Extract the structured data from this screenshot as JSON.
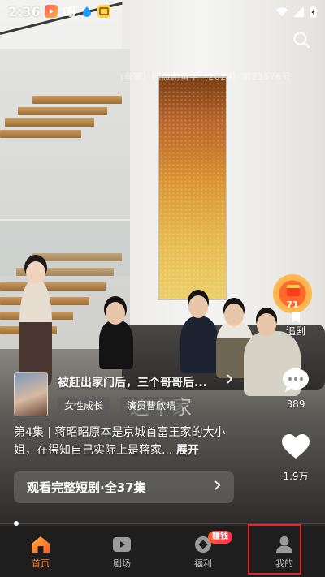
{
  "status_bar": {
    "time": "2:36",
    "app_icons": [
      "video-app-icon",
      "baidu-style-app-icon",
      "water-drop-app-icon",
      "coupon-app-icon"
    ],
    "wifi_icon": "wifi-icon",
    "signal_icon": "cellular-signal-icon",
    "battery_icon": "battery-charging-icon"
  },
  "video": {
    "watermark": "(备案）网微剧备字（2024）第23576号",
    "subtitle": "这个家"
  },
  "actions": {
    "redpacket_count": "71",
    "follow_label": "追剧",
    "comment_count": "389",
    "like_count": "1.9万"
  },
  "drama": {
    "title": "被赶出家门后，三个哥哥后...",
    "tags": [
      "女性成长",
      "演员曹欣晴"
    ],
    "description": "第4集 | 蒋昭昭原本是京城首富王家的大小姐，在得知自己实际上是蒋家...",
    "expand_label": "展开",
    "watch_button": "观看完整短剧·全37集"
  },
  "nav": {
    "items": [
      {
        "label": "首页",
        "icon": "home-icon",
        "active": true
      },
      {
        "label": "剧场",
        "icon": "theater-play-icon",
        "active": false
      },
      {
        "label": "福利",
        "icon": "coin-welfare-icon",
        "active": false,
        "badge": "赚钱"
      },
      {
        "label": "我的",
        "icon": "profile-icon",
        "active": false
      }
    ]
  },
  "colors": {
    "accent": "#ff7a2a",
    "nav_bg": "#1e1e1e",
    "highlight_box": "#e8262b"
  }
}
